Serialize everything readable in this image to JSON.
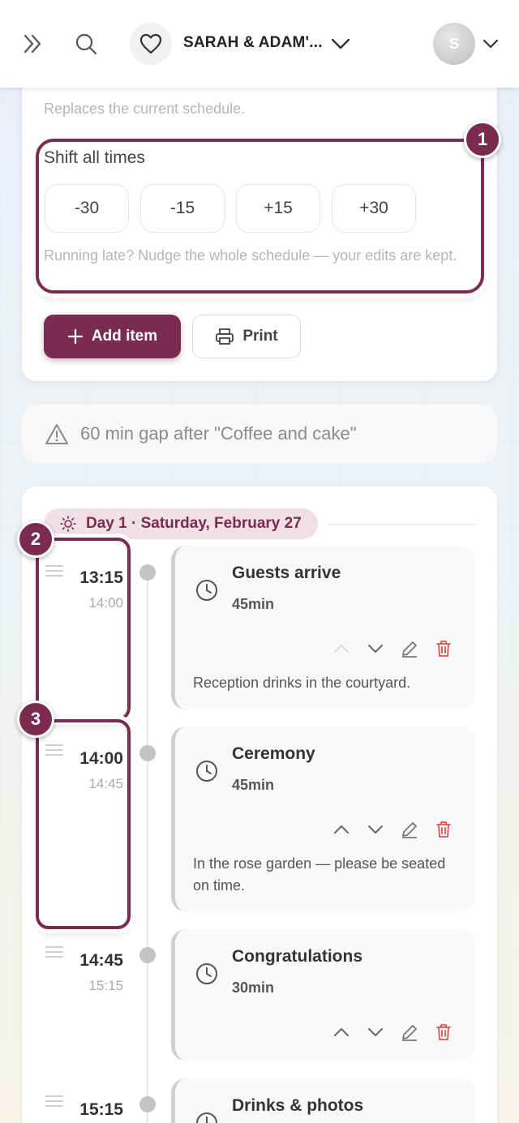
{
  "header": {
    "event_title": "SARAH & ADAM'...",
    "avatar_initial": "S",
    "icons": [
      "expand-icon",
      "search-icon",
      "heart-icon",
      "chevron-down-icon",
      "chevron-down-icon"
    ]
  },
  "schedule_tools": {
    "replaces_text": "Replaces the current schedule.",
    "shift_title": "Shift all times",
    "shift_buttons": [
      "-30",
      "-15",
      "+15",
      "+30"
    ],
    "shift_note": "Running late? Nudge the whole schedule — your edits are kept.",
    "add_item_label": "Add item",
    "print_label": "Print"
  },
  "badges": [
    "1",
    "2",
    "3"
  ],
  "gap_warning": "60 min gap after \"Coffee and cake\"",
  "day": {
    "label": "Day 1 · Saturday, February 27"
  },
  "events": [
    {
      "start": "13:15",
      "end": "14:00",
      "title": "Guests arrive",
      "duration": "45min",
      "description": "Reception drinks in the courtyard.",
      "move_up_enabled": false
    },
    {
      "start": "14:00",
      "end": "14:45",
      "title": "Ceremony",
      "duration": "45min",
      "description": "In the rose garden — please be seated on time.",
      "move_up_enabled": true
    },
    {
      "start": "14:45",
      "end": "15:15",
      "title": "Congratulations",
      "duration": "30min",
      "description": "",
      "move_up_enabled": true
    },
    {
      "start": "15:15",
      "end": "",
      "title": "Drinks & photos",
      "duration": "",
      "description": "",
      "move_up_enabled": true
    }
  ],
  "colors": {
    "accent": "#7a2c50",
    "delete": "#d9534f",
    "pill_bg": "#f0dfe5"
  }
}
